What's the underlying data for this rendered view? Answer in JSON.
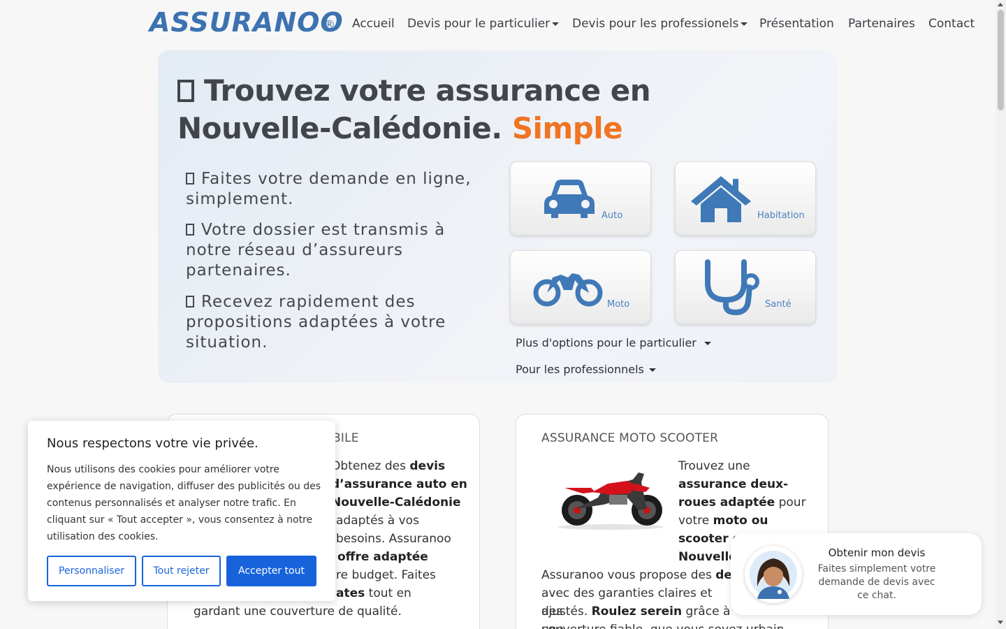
{
  "brand": {
    "name": "ASSURANOO",
    "reg": "®",
    "color": "#3c72b0"
  },
  "nav": {
    "items": [
      {
        "label": "Accueil",
        "dropdown": false
      },
      {
        "label": "Devis pour le particulier",
        "dropdown": true
      },
      {
        "label": "Devis pour les professionels",
        "dropdown": true
      },
      {
        "label": "Présentation",
        "dropdown": false
      },
      {
        "label": "Partenaires",
        "dropdown": false
      },
      {
        "label": "Contact",
        "dropdown": false
      }
    ]
  },
  "hero": {
    "title": "Trouvez votre assurance en Nouvelle-Calédonie.",
    "accent_word": "Simple",
    "accent_color": "#f07423",
    "bullets": [
      "Faites votre demande en ligne, simplement.",
      "Votre dossier est transmis à notre réseau d’assureurs partenaires.",
      "Recevez rapidement des propositions adaptées à votre situation."
    ],
    "tiles": [
      {
        "label": "Auto",
        "icon": "car-icon"
      },
      {
        "label": "Habitation",
        "icon": "house-icon"
      },
      {
        "label": "Moto",
        "icon": "motorcycle-icon"
      },
      {
        "label": "Santé",
        "icon": "stethoscope-icon"
      }
    ],
    "more_options": "Plus d'options pour le particulier",
    "pro_options": "Pour les professionnels"
  },
  "cards": {
    "auto": {
      "title": "BILE",
      "lines": [
        "Obtenez des",
        "devis",
        "d’assurance auto en",
        "Nouvelle-Calédonie",
        "adaptés à vos",
        "besoins. Assuranoo",
        "offre adaptée",
        "re budget. Faites",
        "ates",
        "tout en",
        "gardant une couverture de qualité."
      ]
    },
    "moto": {
      "title": "ASSURANCE MOTO SCOOTER",
      "p1": [
        "Trouvez une",
        "assurance deux-",
        "roues adaptée",
        "pour",
        "votre",
        "moto ou",
        "scooter e",
        "Nouvelle"
      ],
      "p2": [
        "Assuranoo vous propose des",
        "de",
        "avec des garanties claires et des",
        "ajustés.",
        "Roulez serein",
        "grâce à une",
        "couverture fiable, que vous soyez urbain"
      ]
    }
  },
  "cookie": {
    "title": "Nous respectons votre vie privée.",
    "body": "Nous utilisons des cookies pour améliorer votre expérience de navigation, diffuser des publicités ou des contenus personnalisés et analyser notre trafic. En cliquant sur « Tout accepter », vous consentez à notre utilisation des cookies.",
    "customize": "Personnaliser",
    "reject": "Tout rejeter",
    "accept": "Accepter tout",
    "button_color": "#1863dc"
  },
  "chat": {
    "title": "Obtenir mon devis",
    "text": "Faites simplement votre demande de devis avec ce chat."
  }
}
